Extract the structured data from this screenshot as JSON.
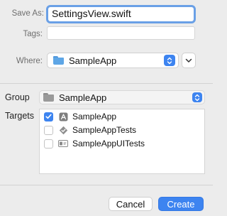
{
  "save_panel": {
    "save_as_label": "Save As:",
    "save_as_value": "SettingsView.swift",
    "tags_label": "Tags:",
    "tags_value": "",
    "where_label": "Where:",
    "where_value": "SampleApp"
  },
  "options": {
    "group_label": "Group",
    "group_value": "SampleApp",
    "targets_label": "Targets",
    "targets": [
      {
        "name": "SampleApp",
        "checked": true,
        "icon": "app-icon"
      },
      {
        "name": "SampleAppTests",
        "checked": false,
        "icon": "test-bundle-icon"
      },
      {
        "name": "SampleAppUITests",
        "checked": false,
        "icon": "ui-test-bundle-icon"
      }
    ]
  },
  "footer": {
    "cancel_label": "Cancel",
    "create_label": "Create"
  },
  "colors": {
    "accent": "#3d84f0",
    "folder_blue": "#5ea6e6",
    "folder_grey": "#9a9a9a"
  }
}
